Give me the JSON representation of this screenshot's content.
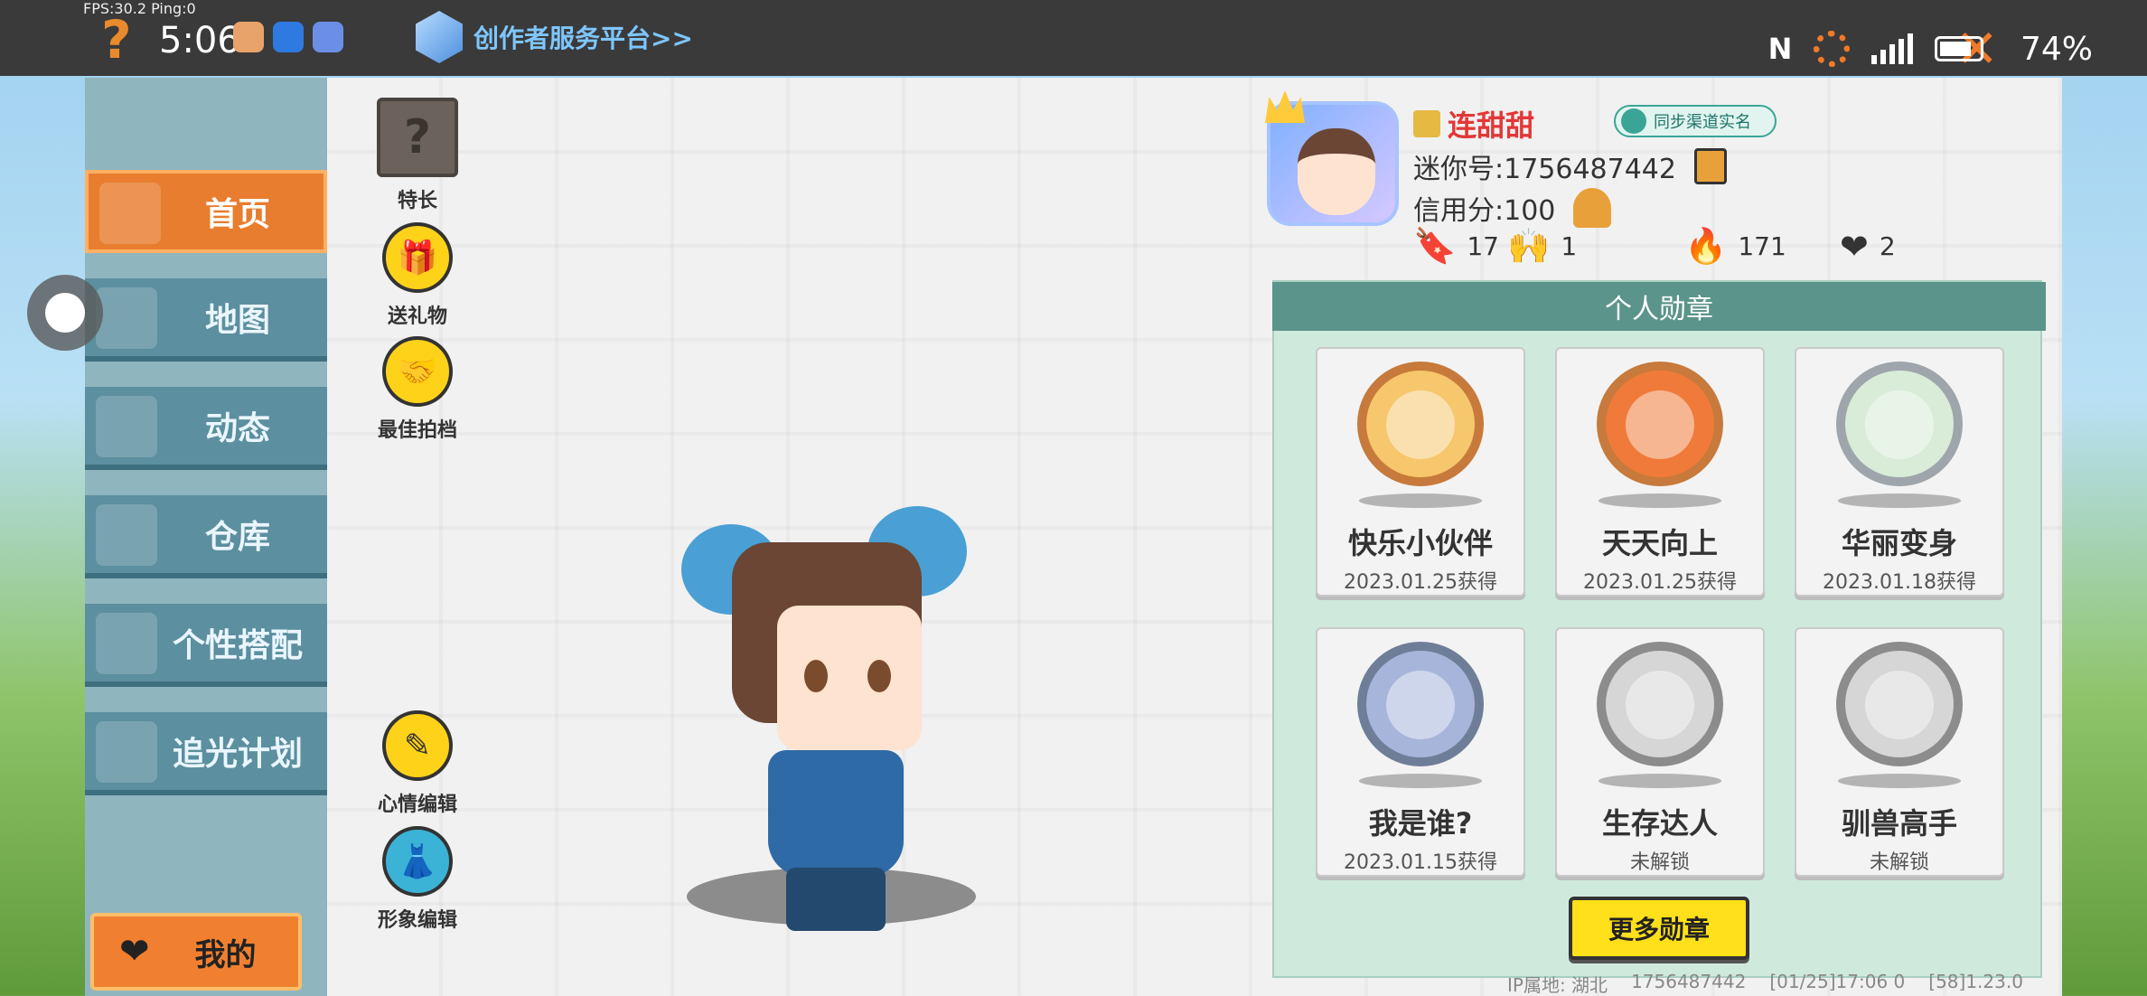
{
  "status_bar": {
    "fps": "FPS:30.2  Ping:0",
    "time": "5:06",
    "creator_link": "创作者服务平台>>",
    "battery": "74%"
  },
  "nav": {
    "items": [
      {
        "label": "首页",
        "icon": "home-icon"
      },
      {
        "label": "地图",
        "icon": "map-icon"
      },
      {
        "label": "动态",
        "icon": "bell-icon"
      },
      {
        "label": "仓库",
        "icon": "house-icon"
      },
      {
        "label": "个性搭配",
        "icon": "skin-icon"
      },
      {
        "label": "追光计划",
        "icon": "plan-icon"
      }
    ],
    "my_label": "我的"
  },
  "actions": {
    "specialty": "特长",
    "send_gift": "送礼物",
    "best_partner": "最佳拍档",
    "mood_edit": "心情编辑",
    "avatar_edit": "形象编辑"
  },
  "profile": {
    "name": "连甜甜",
    "realname_badge": "同步渠道实名",
    "mini_id": "迷你号:1756487442",
    "credit": "信用分:100",
    "stats": {
      "add": "17",
      "fans": "1",
      "hot": "171",
      "likes": "2"
    }
  },
  "medals": {
    "title": "个人勋章",
    "items": [
      {
        "name": "快乐小伙伴",
        "date": "2023.01.25获得"
      },
      {
        "name": "天天向上",
        "date": "2023.01.25获得"
      },
      {
        "name": "华丽变身",
        "date": "2023.01.18获得"
      },
      {
        "name": "我是谁?",
        "date": "2023.01.15获得"
      },
      {
        "name": "生存达人",
        "date": "未解锁"
      },
      {
        "name": "驯兽高手",
        "date": "未解锁"
      }
    ],
    "more_button": "更多勋章"
  },
  "footer": {
    "ip": "IP属地: 湖北",
    "uid": "1756487442",
    "build": "[01/25]17:06 0",
    "version": "[58]1.23.0"
  }
}
